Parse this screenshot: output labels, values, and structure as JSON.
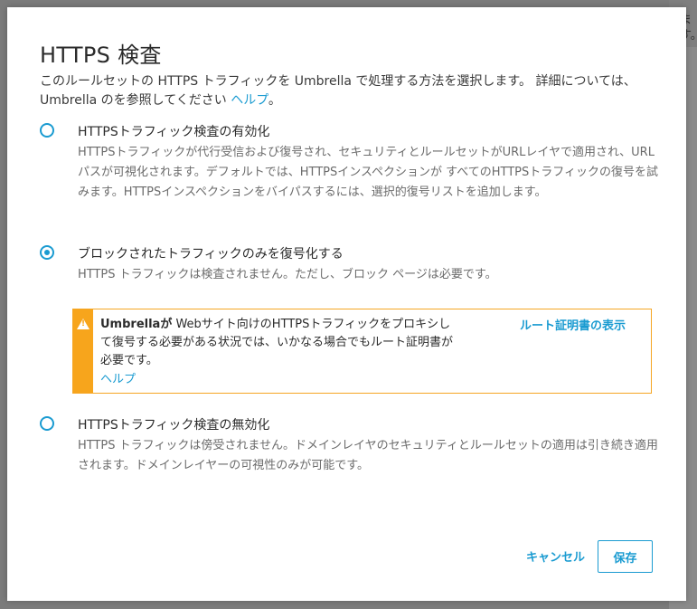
{
  "background": {
    "chars": [
      "ま",
      "す。"
    ]
  },
  "dialog": {
    "title": "HTTPS 検査",
    "description_text": "このルールセットの HTTPS トラフィックを Umbrella で処理する方法を選択します。 詳細については、Umbrella のを参照してください ",
    "description_link": "ヘルプ",
    "description_end": "。"
  },
  "options": [
    {
      "label": "HTTPSトラフィック検査の有効化",
      "description": "HTTPSトラフィックが代行受信および復号され、セキュリティとルールセットがURLレイヤで適用され、URLパスが可視化されます。デフォルトでは、HTTPSインスペクションが すべてのHTTPSトラフィックの復号を試みます。HTTPSインスペクションをバイパスするには、選択的復号リストを追加します。",
      "checked": false
    },
    {
      "label": "ブロックされたトラフィックのみを復号化する",
      "description": "HTTPS トラフィックは検査されません。ただし、ブロック ページは必要です。",
      "checked": true
    },
    {
      "label": "HTTPSトラフィック検査の無効化",
      "description": "HTTPS トラフィックは傍受されません。ドメインレイヤのセキュリティとルールセットの適用は引き続き適用されます。ドメインレイヤーの可視性のみが可能です。",
      "checked": false
    }
  ],
  "alert": {
    "bold": "Umbrellaが",
    "text": " Webサイト向けのHTTPSトラフィックをプロキシして復号する必要がある状況では、いかなる場合でもルート証明書が必要です。",
    "help_link": "ヘルプ",
    "action_link": "ルート証明書の表示"
  },
  "footer": {
    "cancel_label": "キャンセル",
    "save_label": "保存"
  },
  "colors": {
    "accent": "#1a9bd1",
    "warning": "#f7a51c"
  }
}
